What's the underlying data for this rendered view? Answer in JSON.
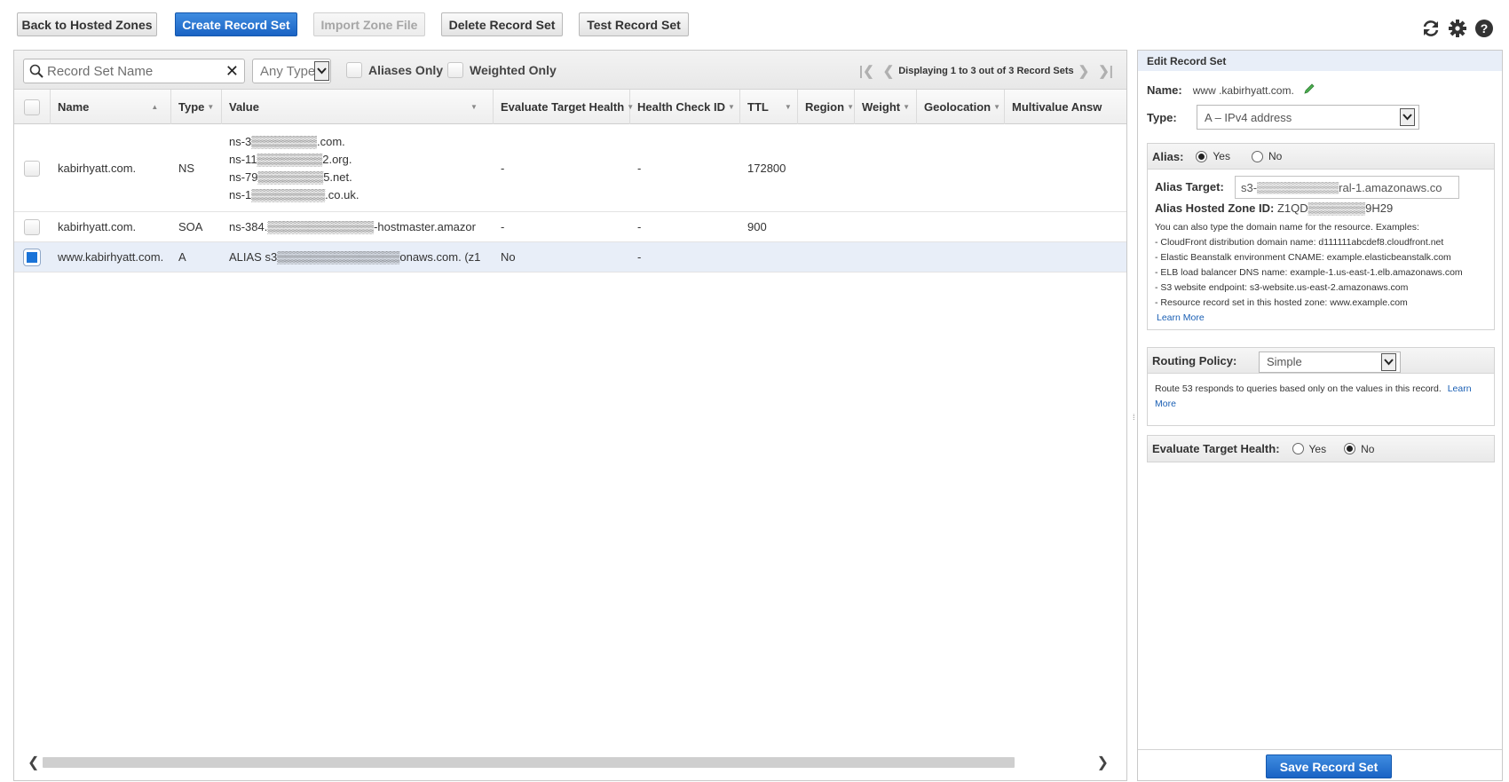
{
  "toolbar": {
    "back_label": "Back to Hosted Zones",
    "create_label": "Create Record Set",
    "import_label": "Import Zone File",
    "delete_label": "Delete Record Set",
    "test_label": "Test Record Set",
    "icons": [
      "refresh-icon",
      "gear-icon",
      "help-icon"
    ]
  },
  "filters": {
    "search_placeholder": "Record Set Name",
    "type_value": "Any Type",
    "aliases_only": "Aliases Only",
    "weighted_only": "Weighted Only",
    "pager_text": "Displaying 1 to 3 out of 3 Record Sets"
  },
  "table": {
    "columns": [
      "Name",
      "Type",
      "Value",
      "Evaluate Target Health",
      "Health Check ID",
      "TTL",
      "Region",
      "Weight",
      "Geolocation",
      "Multivalue Answ"
    ],
    "rows": [
      {
        "name": "kabirhyatt.com.",
        "type": "NS",
        "values": [
          "ns-3▒▒▒▒▒▒▒▒.com.",
          "ns-11▒▒▒▒▒▒▒▒2.org.",
          "ns-79▒▒▒▒▒▒▒▒5.net.",
          "ns-1▒▒▒▒▒▒▒▒▒.co.uk."
        ],
        "eval_health": "-",
        "health_check": "-",
        "ttl": "172800",
        "selected": false
      },
      {
        "name": "kabirhyatt.com.",
        "type": "SOA",
        "values": [
          "ns-384.▒▒▒▒▒▒▒▒▒▒▒▒▒-hostmaster.amazor"
        ],
        "eval_health": "-",
        "health_check": "-",
        "ttl": "900",
        "selected": false
      },
      {
        "name": "www.kabirhyatt.com.",
        "type": "A",
        "values": [
          "ALIAS s3▒▒▒▒▒▒▒▒▒▒▒▒▒▒▒onaws.com. (z1"
        ],
        "eval_health": "No",
        "health_check": "-",
        "ttl": "",
        "selected": true
      }
    ]
  },
  "edit": {
    "title": "Edit Record Set",
    "name_label": "Name:",
    "name_value": "www .kabirhyatt.com.",
    "type_label": "Type:",
    "type_value": "A – IPv4 address",
    "alias_label": "Alias:",
    "alias_yes": "Yes",
    "alias_no": "No",
    "alias_selected": "Yes",
    "alias_target_label": "Alias Target:",
    "alias_target_value": "s3-▒▒▒▒▒▒▒▒▒▒ral-1.amazonaws.co",
    "hosted_zone_label": "Alias Hosted Zone ID:",
    "hosted_zone_value": "Z1QD▒▒▒▒▒▒▒9H29",
    "examples_intro": "You can also type the domain name for the resource. Examples:",
    "examples": [
      "-  CloudFront distribution domain name: d111111abcdef8.cloudfront.net",
      "-  Elastic Beanstalk environment CNAME: example.elasticbeanstalk.com",
      "-  ELB load balancer DNS name: example-1.us-east-1.elb.amazonaws.com",
      "-  S3 website endpoint: s3-website.us-east-2.amazonaws.com",
      "-  Resource record set in this hosted zone: www.example.com"
    ],
    "learn_more": "Learn More",
    "routing_label": "Routing Policy:",
    "routing_value": "Simple",
    "routing_note": "Route 53 responds to queries based only on the values in this record.",
    "routing_learn_1": "Learn",
    "routing_learn_2": "More",
    "eval_label": "Evaluate Target Health:",
    "eval_yes": "Yes",
    "eval_no": "No",
    "eval_selected": "No",
    "save_label": "Save Record Set"
  },
  "colors": {
    "primary_button": "#1a63c4",
    "selected_row": "#e8eef8",
    "link": "#1a5fb4"
  }
}
